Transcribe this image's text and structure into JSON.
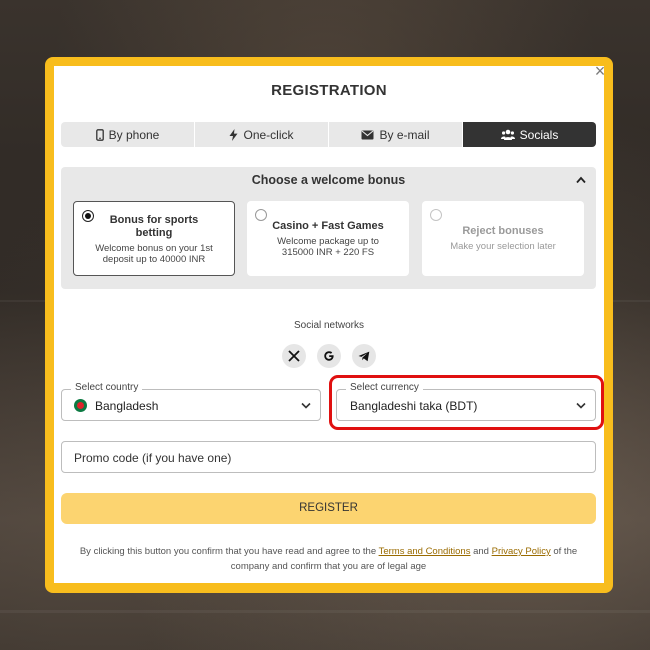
{
  "modal": {
    "title": "REGISTRATION",
    "close_symbol": "×"
  },
  "tabs": [
    {
      "label": "By phone",
      "icon": "phone-icon",
      "active": false
    },
    {
      "label": "One-click",
      "icon": "lightning-icon",
      "active": false
    },
    {
      "label": "By e-mail",
      "icon": "envelope-icon",
      "active": false
    },
    {
      "label": "Socials",
      "icon": "users-icon",
      "active": true
    }
  ],
  "bonus": {
    "header": "Choose a welcome bonus",
    "options": [
      {
        "title": "Bonus for sports betting",
        "description": "Welcome bonus on your 1st deposit up to 40000 INR",
        "selected": true
      },
      {
        "title": "Casino + Fast Games",
        "description": "Welcome package up to 315000 INR + 220 FS",
        "selected": false
      },
      {
        "title": "Reject bonuses",
        "description": "Make your selection later",
        "selected": false
      }
    ]
  },
  "social": {
    "label": "Social networks",
    "networks": [
      "x-icon",
      "google-icon",
      "telegram-icon"
    ]
  },
  "country": {
    "label": "Select country",
    "value": "Bangladesh"
  },
  "currency": {
    "label": "Select currency",
    "value": "Bangladeshi taka (BDT)"
  },
  "promo": {
    "placeholder": "Promo code (if you have one)"
  },
  "register": {
    "label": "REGISTER"
  },
  "terms": {
    "before": "By clicking this button you confirm that you have read and agree to the ",
    "terms_link": "Terms and Conditions",
    "and": " and ",
    "privacy_link": "Privacy Policy",
    "after": " of the company and confirm that you are of legal age"
  },
  "colors": {
    "frame": "#f8bd1d",
    "active_tab": "#333333",
    "register_button": "#fcd470",
    "highlight": "#e01010",
    "link": "#9a6b00"
  }
}
